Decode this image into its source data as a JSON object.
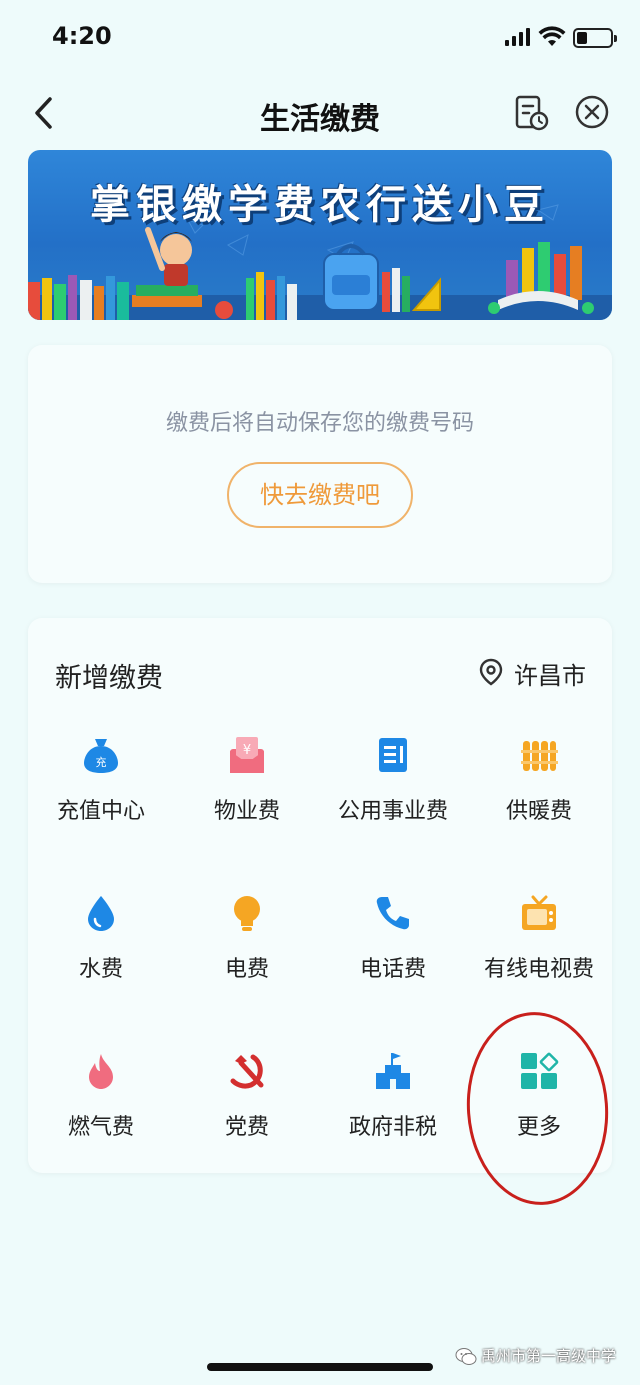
{
  "status_bar": {
    "time": "4:20"
  },
  "nav": {
    "title": "生活缴费"
  },
  "banner": {
    "title": "掌银缴学费农行送小豆"
  },
  "saved_numbers": {
    "empty_text": "缴费后将自动保存您的缴费号码",
    "pay_button": "快去缴费吧"
  },
  "new_payment": {
    "title": "新增缴费",
    "location": "许昌市",
    "items": [
      {
        "label": "充值中心",
        "icon": "money-bag-icon",
        "color": "#1e88e5"
      },
      {
        "label": "物业费",
        "icon": "envelope-yuan-icon",
        "color": "#f06c7f"
      },
      {
        "label": "公用事业费",
        "icon": "document-icon",
        "color": "#1e88e5"
      },
      {
        "label": "供暖费",
        "icon": "radiator-icon",
        "color": "#f5a623"
      },
      {
        "label": "水费",
        "icon": "water-drop-icon",
        "color": "#1e88e5"
      },
      {
        "label": "电费",
        "icon": "light-bulb-icon",
        "color": "#f5a623"
      },
      {
        "label": "电话费",
        "icon": "phone-icon",
        "color": "#1e88e5"
      },
      {
        "label": "有线电视费",
        "icon": "tv-icon",
        "color": "#f5a623"
      },
      {
        "label": "燃气费",
        "icon": "flame-icon",
        "color": "#f06c7f"
      },
      {
        "label": "党费",
        "icon": "party-emblem-icon",
        "color": "#d32f2f"
      },
      {
        "label": "政府非税",
        "icon": "government-building-icon",
        "color": "#1e88e5"
      },
      {
        "label": "更多",
        "icon": "more-apps-icon",
        "color": "#1fb5a8"
      }
    ]
  },
  "badges": {
    "recharge_icon_text": "充",
    "property_icon_text": "¥"
  },
  "watermark": {
    "text": "禹州市第一高级中学"
  },
  "colors": {
    "accent_orange": "#ef9a3a",
    "annotation_red": "#c8201c",
    "background": "#eefbfb"
  }
}
